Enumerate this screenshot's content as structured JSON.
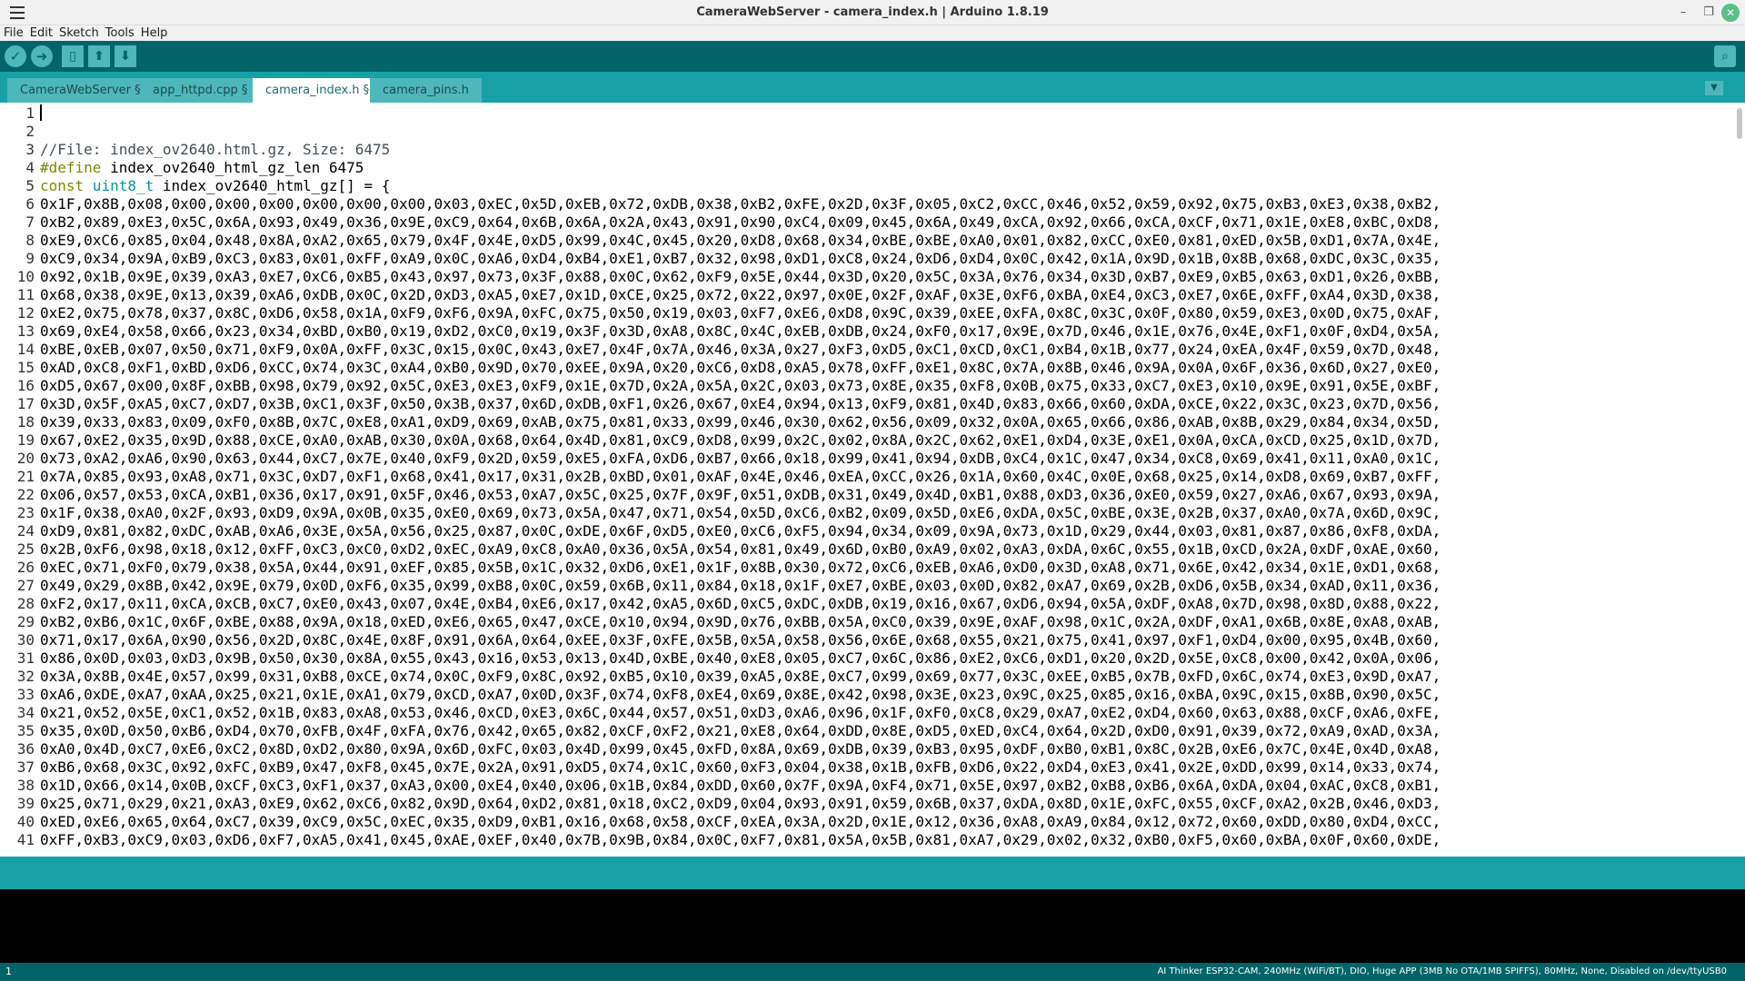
{
  "window": {
    "title": "CameraWebServer - camera_index.h | Arduino 1.8.19"
  },
  "menubar": {
    "items": [
      "File",
      "Edit",
      "Sketch",
      "Tools",
      "Help"
    ]
  },
  "toolbar": {
    "verify_icon": "check-icon",
    "upload_icon": "arrow-right-icon",
    "new_icon": "new-file-icon",
    "open_icon": "arrow-up-icon",
    "save_icon": "arrow-down-icon",
    "serial_icon": "magnifier-icon"
  },
  "tabs": [
    {
      "label": "CameraWebServer §",
      "active": false
    },
    {
      "label": "app_httpd.cpp §",
      "active": false
    },
    {
      "label": "camera_index.h §",
      "active": true
    },
    {
      "label": "camera_pins.h",
      "active": false
    }
  ],
  "editor": {
    "lines": [
      "",
      "",
      "//File: index_ov2640.html.gz, Size: 6475",
      "#define index_ov2640_html_gz_len 6475",
      "const uint8_t index_ov2640_html_gz[] = {",
      "0x1F,0x8B,0x08,0x00,0x00,0x00,0x00,0x00,0x00,0x03,0xEC,0x5D,0xEB,0x72,0xDB,0x38,0xB2,0xFE,0x2D,0x3F,0x05,0xC2,0xCC,0x46,0x52,0x59,0x92,0x75,0xB3,0xE3,0x38,0xB2,",
      "0xB2,0x89,0xE3,0x5C,0x6A,0x93,0x49,0x36,0x9E,0xC9,0x64,0x6B,0x6A,0x2A,0x43,0x91,0x90,0xC4,0x09,0x45,0x6A,0x49,0xCA,0x92,0x66,0xCA,0xCF,0x71,0x1E,0xE8,0xBC,0xD8,",
      "0xE9,0xC6,0x85,0x04,0x48,0x8A,0xA2,0x65,0x79,0x4F,0x4E,0xD5,0x99,0x4C,0x45,0x20,0xD8,0x68,0x34,0xBE,0xBE,0xA0,0x01,0x82,0xCC,0xE0,0x81,0xED,0x5B,0xD1,0x7A,0x4E,",
      "0xC9,0x34,0x9A,0xB9,0xC3,0x83,0x01,0xFF,0xA9,0x0C,0xA6,0xD4,0xB4,0xE1,0xB7,0x32,0x98,0xD1,0xC8,0x24,0xD6,0xD4,0x0C,0x42,0x1A,0x9D,0x1B,0x8B,0x68,0xDC,0x3C,0x35,",
      "0x92,0x1B,0x9E,0x39,0xA3,0xE7,0xC6,0xB5,0x43,0x97,0x73,0x3F,0x88,0x0C,0x62,0xF9,0x5E,0x44,0x3D,0x20,0x5C,0x3A,0x76,0x34,0x3D,0xB7,0xE9,0xB5,0x63,0xD1,0x26,0xBB,",
      "0x68,0x38,0x9E,0x13,0x39,0xA6,0xDB,0x0C,0x2D,0xD3,0xA5,0xE7,0x1D,0xCE,0x25,0x72,0x22,0x97,0x0E,0x2F,0xAF,0x3E,0xF6,0xBA,0xE4,0xC3,0xE7,0x6E,0xFF,0xA4,0x3D,0x38,",
      "0xE2,0x75,0x78,0x37,0x8C,0xD6,0x58,0x1A,0xF9,0xF6,0x9A,0xFC,0x75,0x50,0x19,0x03,0xF7,0xE6,0xD8,0x9C,0x39,0xEE,0xFA,0x8C,0x3C,0x0F,0x80,0x59,0xE3,0x0D,0x75,0xAF,",
      "0x69,0xE4,0x58,0x66,0x23,0x34,0xBD,0xB0,0x19,0xD2,0xC0,0x19,0x3F,0x3D,0xA8,0x8C,0x4C,0xEB,0xDB,0x24,0xF0,0x17,0x9E,0x7D,0x46,0x1E,0x76,0x4E,0xF1,0x0F,0xD4,0x5A,",
      "0xBE,0xEB,0x07,0x50,0x71,0xF9,0x0A,0xFF,0x3C,0x15,0x0C,0x43,0xE7,0x4F,0x7A,0x46,0x3A,0x27,0xF3,0xD5,0xC1,0xCD,0xC1,0xB4,0x1B,0x77,0x24,0xEA,0x4F,0x59,0x7D,0x48,",
      "0xAD,0xC8,0xF1,0xBD,0xD6,0xCC,0x74,0x3C,0xA4,0xB0,0x9D,0x70,0xEE,0x9A,0x20,0xC6,0xD8,0xA5,0x78,0xFF,0xE1,0x8C,0x7A,0x8B,0x46,0x9A,0x0A,0x6F,0x36,0x6D,0x27,0xE0,",
      "0xD5,0x67,0x00,0x8F,0xBB,0x98,0x79,0x92,0x5C,0xE3,0xE3,0xF9,0x1E,0x7D,0x2A,0x5A,0x2C,0x03,0x73,0x8E,0x35,0xF8,0x0B,0x75,0x33,0xC7,0xE3,0x10,0x9E,0x91,0x5E,0xBF,",
      "0x3D,0x5F,0xA5,0xC7,0xD7,0x3B,0xC1,0x3F,0x50,0x3B,0x37,0x6D,0xDB,0xF1,0x26,0x67,0xE4,0x94,0x13,0xF9,0x81,0x4D,0x83,0x66,0x60,0xDA,0xCE,0x22,0x3C,0x23,0x7D,0x56,",
      "0x39,0x33,0x83,0x09,0xF0,0x8B,0x7C,0xE8,0xA1,0xD9,0x69,0xAB,0x75,0x81,0x33,0x99,0x46,0x30,0x62,0x56,0x09,0x32,0x0A,0x65,0x66,0x86,0xAB,0x8B,0x29,0x84,0x34,0x5D,",
      "0x67,0xE2,0x35,0x9D,0x88,0xCE,0xA0,0xAB,0x30,0x0A,0x68,0x64,0x4D,0x81,0xC9,0xD8,0x99,0x2C,0x02,0x8A,0x2C,0x62,0xE1,0xD4,0x3E,0xE1,0x0A,0xCA,0xCD,0x25,0x1D,0x7D,",
      "0x73,0xA2,0xA6,0x90,0x63,0x44,0xC7,0x7E,0x40,0xF9,0x2D,0x59,0xE5,0xFA,0xD6,0xB7,0x66,0x18,0x99,0x41,0x94,0xDB,0xC4,0x1C,0x47,0x34,0xC8,0x69,0x41,0x11,0xA0,0x1C,",
      "0x7A,0x85,0x93,0xA8,0x71,0x3C,0xD7,0xF1,0x68,0x41,0x17,0x31,0x2B,0xBD,0x01,0xAF,0x4E,0x46,0xEA,0xCC,0x26,0x1A,0x60,0x4C,0x0E,0x68,0x25,0x14,0xD8,0x69,0xB7,0xFF,",
      "0x06,0x57,0x53,0xCA,0xB1,0x36,0x17,0x91,0x5F,0x46,0x53,0xA7,0x5C,0x25,0x7F,0x9F,0x51,0xDB,0x31,0x49,0x4D,0xB1,0x88,0xD3,0x36,0xE0,0x59,0x27,0xA6,0x67,0x93,0x9A,",
      "0x1F,0x38,0xA0,0x2F,0x93,0xD9,0x9A,0x0B,0x35,0xE0,0x69,0x73,0x5A,0x47,0x71,0x54,0x5D,0xC6,0xB2,0x09,0x5D,0xE6,0xDA,0x5C,0xBE,0x3E,0x2B,0x37,0xA0,0x7A,0x6D,0x9C,",
      "0xD9,0x81,0x82,0xDC,0xAB,0xA6,0x3E,0x5A,0x56,0x25,0x87,0x0C,0xDE,0x6F,0xD5,0xE0,0xC6,0xF5,0x94,0x34,0x09,0x9A,0x73,0x1D,0x29,0x44,0x03,0x81,0x87,0x86,0xF8,0xDA,",
      "0x2B,0xF6,0x98,0x18,0x12,0xFF,0xC3,0xC0,0xD2,0xEC,0xA9,0xC8,0xA0,0x36,0x5A,0x54,0x81,0x49,0x6D,0xB0,0xA9,0x02,0xA3,0xDA,0x6C,0x55,0x1B,0xCD,0x2A,0xDF,0xAE,0x60,",
      "0xEC,0x71,0xF0,0x79,0x38,0x5A,0x44,0x91,0xEF,0x85,0x5B,0x1C,0x32,0xD6,0xE1,0x1F,0x8B,0x30,0x72,0xC6,0xEB,0xA6,0xD0,0x3D,0xA8,0x71,0x6E,0x42,0x34,0x1E,0xD1,0x68,",
      "0x49,0x29,0x8B,0x42,0x9E,0x79,0x0D,0xF6,0x35,0x99,0xB8,0x0C,0x59,0x6B,0x11,0x84,0x18,0x1F,0xE7,0xBE,0x03,0x0D,0x82,0xA7,0x69,0x2B,0xD6,0x5B,0x34,0xAD,0x11,0x36,",
      "0xF2,0x17,0x11,0xCA,0xCB,0xC7,0xE0,0x43,0x07,0x4E,0xB4,0xE6,0x17,0x42,0xA5,0x6D,0xC5,0xDC,0xDB,0x19,0x16,0x67,0xD6,0x94,0x5A,0xDF,0xA8,0x7D,0x98,0x8D,0x88,0x22,",
      "0xB2,0xB6,0x1C,0x6F,0xBE,0x88,0x9A,0x18,0xED,0xE6,0x65,0x47,0xCE,0x10,0x94,0x9D,0x76,0xBB,0x5A,0xC0,0x39,0x9E,0xAF,0x98,0x1C,0x2A,0xDF,0xA1,0x6B,0x8E,0xA8,0xAB,",
      "0x71,0x17,0x6A,0x90,0x56,0x2D,0x8C,0x4E,0x8F,0x91,0x6A,0x64,0xEE,0x3F,0xFE,0x5B,0x5A,0x58,0x56,0x6E,0x68,0x55,0x21,0x75,0x41,0x97,0xF1,0xD4,0x00,0x95,0x4B,0x60,",
      "0x86,0x0D,0x03,0xD3,0x9B,0x50,0x30,0x8A,0x55,0x43,0x16,0x53,0x13,0x4D,0xBE,0x40,0xE8,0x05,0xC7,0x6C,0x86,0xE2,0xC6,0xD1,0x20,0x2D,0x5E,0xC8,0x00,0x42,0x0A,0x06,",
      "0x3A,0x8B,0x4E,0x57,0x99,0x31,0xB8,0xCE,0x74,0x0C,0xF9,0x8C,0x92,0xB5,0x10,0x39,0xA5,0x8E,0xC7,0x99,0x69,0x77,0x3C,0xEE,0xB5,0x7B,0xFD,0x6C,0x74,0xE3,0x9D,0xA7,",
      "0xA6,0xDE,0xA7,0xAA,0x25,0x21,0x1E,0xA1,0x79,0xCD,0xA7,0x0D,0x3F,0x74,0xF8,0xE4,0x69,0x8E,0x42,0x98,0x3E,0x23,0x9C,0x25,0x85,0x16,0xBA,0x9C,0x15,0x8B,0x90,0x5C,",
      "0x21,0x52,0x5E,0xC1,0x52,0x1B,0x83,0xA8,0x53,0x46,0xCD,0xE3,0x6C,0x44,0x57,0x51,0xD3,0xA6,0x96,0x1F,0xF0,0xC8,0x29,0xA7,0xE2,0xD4,0x60,0x63,0x88,0xCF,0xA6,0xFE,",
      "0x35,0x0D,0x50,0xB6,0xD4,0x70,0xFB,0x4F,0xFA,0x76,0x42,0x65,0x82,0xCF,0xF2,0x21,0xE8,0x64,0xDD,0x8E,0xD5,0xED,0xC4,0x64,0x2D,0xD0,0x91,0x39,0x72,0xA9,0xAD,0x3A,",
      "0xA0,0x4D,0xC7,0xE6,0xC2,0x8D,0xD2,0x80,0x9A,0x6D,0xFC,0x03,0x4D,0x99,0x45,0xFD,0x8A,0x69,0xDB,0x39,0xB3,0x95,0xDF,0xB0,0xB1,0x8C,0x2B,0xE6,0x7C,0x4E,0x4D,0xA8,",
      "0xB6,0x68,0x3C,0x92,0xFC,0xB9,0x47,0xF8,0x45,0x7E,0x2A,0x91,0xD5,0x74,0x1C,0x60,0xF3,0x04,0x38,0x1B,0xFB,0xD6,0x22,0xD4,0xE3,0x41,0x2E,0xDD,0x99,0x14,0x33,0x74,",
      "0x1D,0x66,0x14,0x0B,0xCF,0xC3,0xF1,0x37,0xA3,0x00,0xE4,0x40,0x06,0x1B,0x84,0xDD,0x60,0x7F,0x9A,0xF4,0x71,0x5E,0x97,0xB2,0xB8,0xB6,0x6A,0xDA,0x04,0xAC,0xC8,0xB1,",
      "0x25,0x71,0x29,0x21,0xA3,0xE9,0x62,0xC6,0x82,0x9D,0x64,0xD2,0x81,0x18,0xC2,0xD9,0x04,0x93,0x91,0x59,0x6B,0x37,0xDA,0x8D,0x1E,0xFC,0x55,0xCF,0xA2,0x2B,0x46,0xD3,",
      "0xED,0xE6,0x65,0x64,0xC7,0x39,0xC9,0x5C,0xEC,0x35,0xD9,0xB1,0x16,0x68,0x58,0xCF,0xEA,0x3A,0x2D,0x1E,0x12,0x36,0xA8,0xA9,0x84,0x12,0x72,0x60,0xDD,0x80,0xD4,0xCC,",
      "0xFF,0xB3,0xC9,0x03,0xD6,0xF7,0xA5,0x41,0x45,0xAE,0xEF,0x40,0x7B,0x9B,0x84,0x0C,0xF7,0x81,0x5A,0x5B,0x81,0xA7,0x29,0x02,0x32,0xB0,0xF5,0x60,0xBA,0x0F,0x60,0xDE,"
    ]
  },
  "status": {
    "line": "1",
    "board": "AI Thinker ESP32-CAM, 240MHz (WiFi/BT), DIO, Huge APP (3MB No OTA/1MB SPIFFS), 80MHz, None, Disabled on /dev/ttyUSB0"
  },
  "colors": {
    "toolbar": "#006468",
    "tabbar": "#17a1a5",
    "button": "#4db7bb",
    "comment": "#434f54",
    "keyword": "#728e00",
    "type": "#00979c"
  }
}
